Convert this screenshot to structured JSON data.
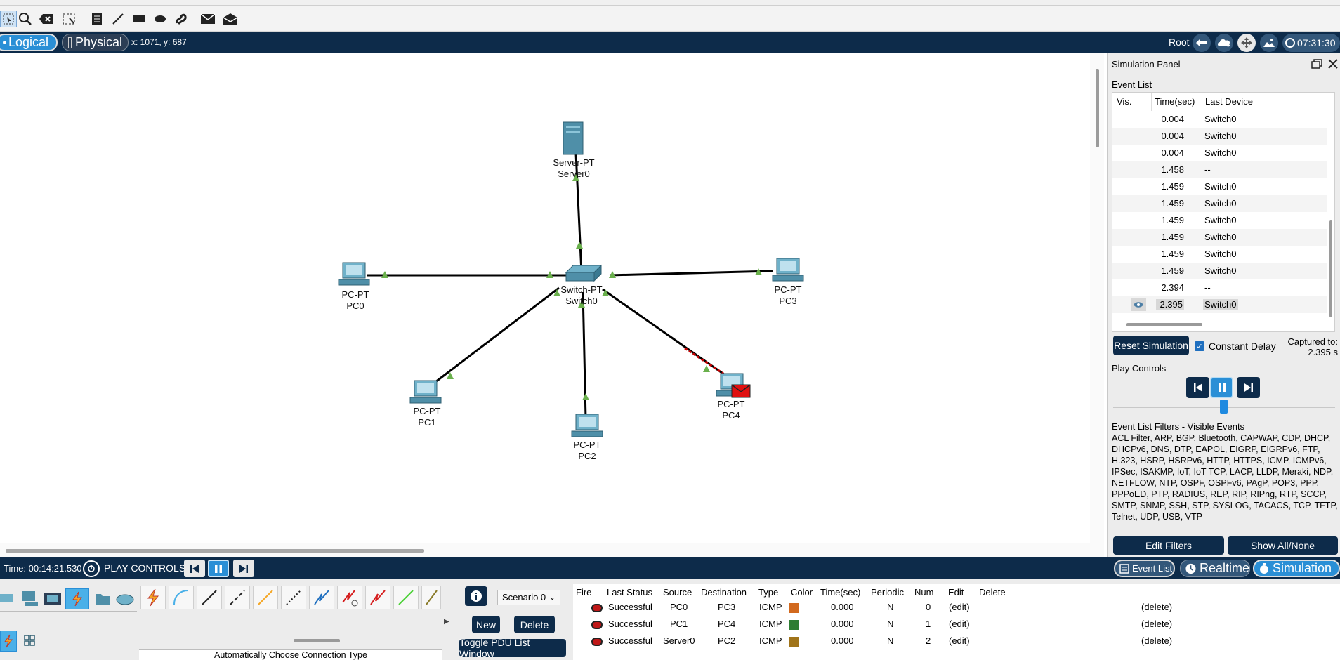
{
  "mode_bar": {
    "logical_label": "Logical",
    "physical_label": "Physical",
    "coords": "x: 1071, y: 687",
    "root_label": "Root",
    "clock": "07:31:30"
  },
  "topology": {
    "devices": [
      {
        "id": "server0",
        "type_label": "Server-PT",
        "name": "Server0"
      },
      {
        "id": "pc0",
        "type_label": "PC-PT",
        "name": "PC0"
      },
      {
        "id": "switch0",
        "type_label": "Switch-PT",
        "name": "Switch0"
      },
      {
        "id": "pc3",
        "type_label": "PC-PT",
        "name": "PC3"
      },
      {
        "id": "pc1",
        "type_label": "PC-PT",
        "name": "PC1"
      },
      {
        "id": "pc2",
        "type_label": "PC-PT",
        "name": "PC2"
      },
      {
        "id": "pc4",
        "type_label": "PC-PT",
        "name": "PC4"
      }
    ],
    "link_color": "#000000",
    "link_light_color": "#6ab04c",
    "pdu_color": "#cc0000"
  },
  "simulation_panel": {
    "title": "Simulation Panel",
    "event_list_label": "Event List",
    "columns": [
      "Vis.",
      "Time(sec)",
      "Last Device"
    ],
    "events": [
      {
        "time": "0.004",
        "last_device": "Switch0"
      },
      {
        "time": "0.004",
        "last_device": "Switch0"
      },
      {
        "time": "0.004",
        "last_device": "Switch0"
      },
      {
        "time": "1.458",
        "last_device": "--"
      },
      {
        "time": "1.459",
        "last_device": "Switch0"
      },
      {
        "time": "1.459",
        "last_device": "Switch0"
      },
      {
        "time": "1.459",
        "last_device": "Switch0"
      },
      {
        "time": "1.459",
        "last_device": "Switch0"
      },
      {
        "time": "1.459",
        "last_device": "Switch0"
      },
      {
        "time": "1.459",
        "last_device": "Switch0"
      },
      {
        "time": "2.394",
        "last_device": "--"
      },
      {
        "time": "2.395",
        "last_device": "Switch0",
        "current": true
      }
    ],
    "reset_label": "Reset Simulation",
    "constant_delay_label": "Constant Delay",
    "constant_delay_checked": true,
    "captured_label": "Captured to:",
    "captured_value": "2.395 s",
    "play_controls_label": "Play Controls",
    "filters_label": "Event List Filters - Visible Events",
    "filters_text": "ACL Filter, ARP, BGP, Bluetooth, CAPWAP, CDP, DHCP, DHCPv6, DNS, DTP, EAPOL, EIGRP, EIGRPv6, FTP, H.323, HSRP, HSRPv6, HTTP, HTTPS, ICMP, ICMPv6, IPSec, ISAKMP, IoT, IoT TCP, LACP, LLDP, Meraki, NDP, NETFLOW, NTP, OSPF, OSPFv6, PAgP, POP3, PPP, PPPoED, PTP, RADIUS, REP, RIP, RIPng, RTP, SCCP, SMTP, SNMP, SSH, STP, SYSLOG, TACACS, TCP, TFTP, Telnet, UDP, USB, VTP",
    "edit_filters_label": "Edit Filters",
    "show_all_label": "Show All/None"
  },
  "status_bar": {
    "time": "Time: 00:14:21.530",
    "play_controls": "PLAY CONTROLS:",
    "event_list_tab": "Event List",
    "realtime_tab": "Realtime",
    "simulation_tab": "Simulation"
  },
  "bottom": {
    "auto_connection_label": "Automatically Choose Connection Type",
    "scenario": "Scenario 0",
    "new_label": "New",
    "delete_label": "Delete",
    "toggle_pdu_label": "Toggle PDU List Window",
    "pdu_columns": [
      "Fire",
      "Last Status",
      "Source",
      "Destination",
      "Type",
      "Color",
      "Time(sec)",
      "Periodic",
      "Num",
      "Edit",
      "Delete"
    ],
    "pdus": [
      {
        "status": "Successful",
        "source": "PC0",
        "destination": "PC3",
        "type": "ICMP",
        "color": "#d2691e",
        "time": "0.000",
        "periodic": "N",
        "num": "0",
        "edit": "(edit)",
        "delete": "(delete)"
      },
      {
        "status": "Successful",
        "source": "PC1",
        "destination": "PC4",
        "type": "ICMP",
        "color": "#2e7d32",
        "time": "0.000",
        "periodic": "N",
        "num": "1",
        "edit": "(edit)",
        "delete": "(delete)"
      },
      {
        "status": "Successful",
        "source": "Server0",
        "destination": "PC2",
        "type": "ICMP",
        "color": "#a0741a",
        "time": "0.000",
        "periodic": "N",
        "num": "2",
        "edit": "(edit)",
        "delete": "(delete)"
      }
    ]
  }
}
